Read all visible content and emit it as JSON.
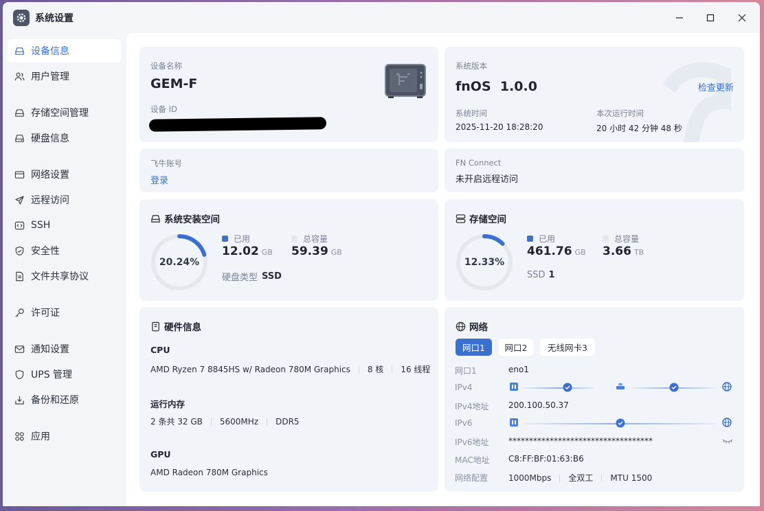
{
  "window": {
    "title": "系统设置",
    "app_icon": "gear-icon",
    "controls": [
      "minimize-icon",
      "maximize-icon",
      "close-icon"
    ]
  },
  "sidebar": {
    "items": [
      {
        "label": "设备信息",
        "icon": "device-icon",
        "active": true
      },
      {
        "label": "用户管理",
        "icon": "users-icon"
      },
      {
        "label": "存储空间管理",
        "icon": "storage-icon"
      },
      {
        "label": "硬盘信息",
        "icon": "disk-icon"
      },
      {
        "label": "网络设置",
        "icon": "network-icon"
      },
      {
        "label": "远程访问",
        "icon": "send-icon"
      },
      {
        "label": "SSH",
        "icon": "code-icon"
      },
      {
        "label": "安全性",
        "icon": "shield-icon"
      },
      {
        "label": "文件共享协议",
        "icon": "file-icon"
      },
      {
        "label": "许可证",
        "icon": "key-icon"
      },
      {
        "label": "通知设置",
        "icon": "mail-icon"
      },
      {
        "label": "UPS 管理",
        "icon": "ups-shield-icon"
      },
      {
        "label": "备份和还原",
        "icon": "backup-icon"
      },
      {
        "label": "应用",
        "icon": "apps-icon"
      }
    ]
  },
  "device": {
    "name_label": "设备名称",
    "name": "GEM-F",
    "id_label": "设备 ID",
    "id_value": ""
  },
  "system": {
    "version_label": "系统版本",
    "version": "fnOS  1.0.0",
    "check_update": "检查更新",
    "time_label": "系统时间",
    "time": "2025-11-20 18:28:20",
    "uptime_label": "本次运行时间",
    "uptime": "20 小时 42 分钟 48 秒"
  },
  "account": {
    "label": "飞牛账号",
    "login": "登录"
  },
  "fnconnect": {
    "label": "FN Connect",
    "status": "未开启远程访问"
  },
  "system_space": {
    "title": "系统安装空间",
    "percent_text": "20.24%",
    "percent": 0.2024,
    "used_label": "已用",
    "used": "12.02",
    "used_unit": "GB",
    "total_label": "总容量",
    "total": "59.39",
    "total_unit": "GB",
    "disk_type_label": "硬盘类型",
    "disk_type": "SSD"
  },
  "storage": {
    "title": "存储空间",
    "percent_text": "12.33%",
    "percent": 0.1233,
    "used_label": "已用",
    "used": "461.76",
    "used_unit": "GB",
    "total_label": "总容量",
    "total": "3.66",
    "total_unit": "TB",
    "ssd_label": "SSD",
    "ssd_count": "1"
  },
  "hardware": {
    "title": "硬件信息",
    "cpu_label": "CPU",
    "cpu_model": "AMD Ryzen 7 8845HS w/ Radeon 780M Graphics",
    "cpu_cores": "8 核",
    "cpu_threads": "16 线程",
    "mem_label": "运行内存",
    "mem_size": "2 条共 32 GB",
    "mem_speed": "5600MHz",
    "mem_type": "DDR5",
    "gpu_label": "GPU",
    "gpu_model": "AMD Radeon 780M Graphics"
  },
  "network": {
    "title": "网络",
    "tabs": [
      "网口1",
      "网口2",
      "无线网卡3"
    ],
    "active_tab": 0,
    "port_label": "网口1",
    "port_value": "eno1",
    "ipv4_label": "IPv4",
    "ipv4_addr_label": "IPv4地址",
    "ipv4_addr": "200.100.50.37",
    "ipv6_label": "IPv6",
    "ipv6_addr_label": "IPv6地址",
    "ipv6_addr": "***********************************",
    "mac_label": "MAC地址",
    "mac": "C8:FF:BF:01:63:B6",
    "config_label": "网络配置",
    "speed": "1000Mbps",
    "duplex": "全双工",
    "mtu": "MTU 1500"
  },
  "colors": {
    "accent": "#3a70d2",
    "ring_track": "#e4e7ec",
    "card_bg": "#f1f4f8"
  }
}
